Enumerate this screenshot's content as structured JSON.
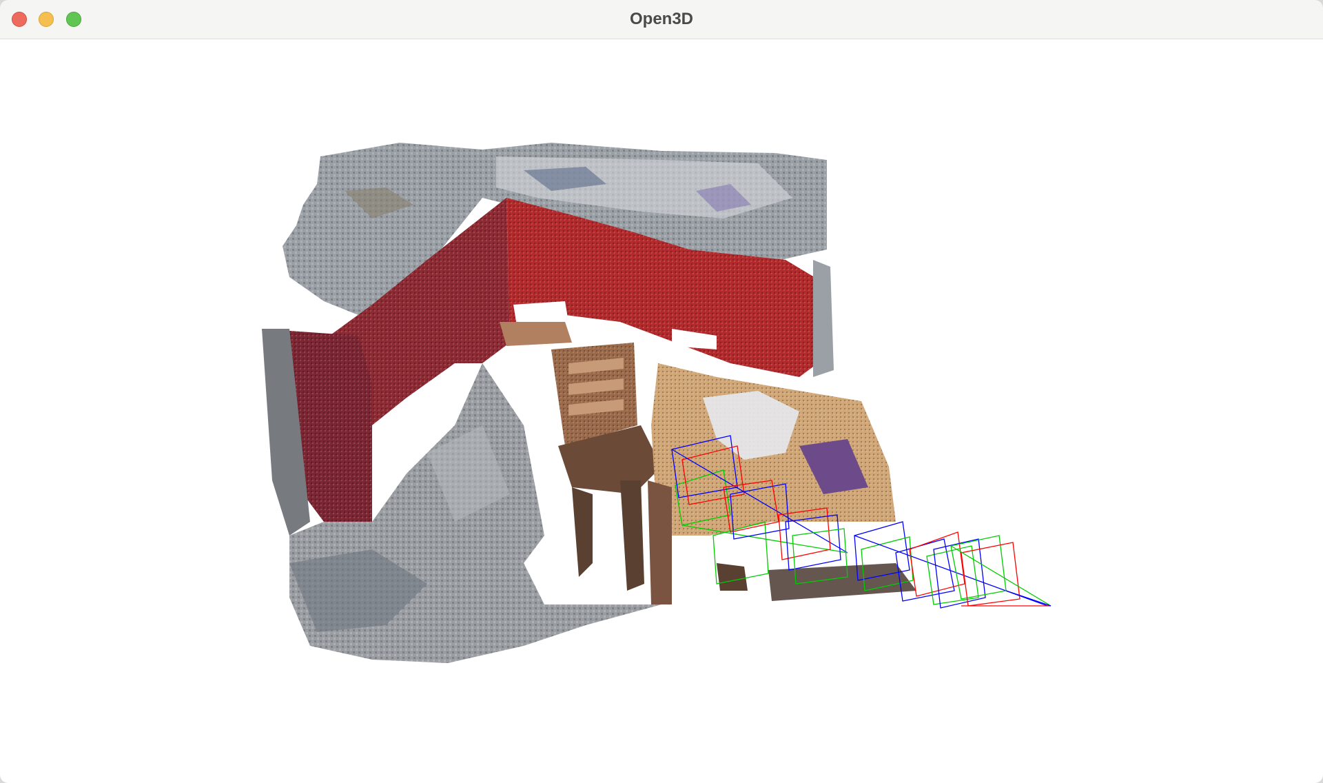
{
  "window": {
    "title": "Open3D",
    "buttons": [
      "close",
      "minimize",
      "maximize"
    ]
  },
  "viewport": {
    "background": "#ffffff",
    "content": "point-cloud",
    "camera_frustum_colors": [
      "#ff0000",
      "#00cc00",
      "#0000ff"
    ]
  }
}
